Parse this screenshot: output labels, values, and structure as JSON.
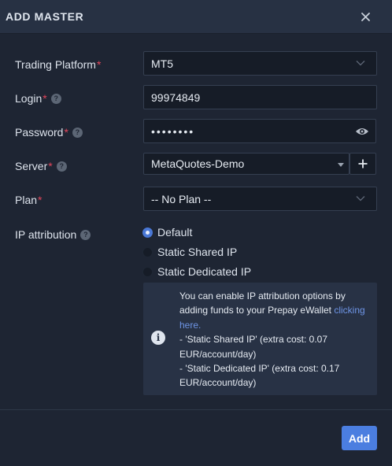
{
  "dialog": {
    "title": "ADD MASTER",
    "close_icon": "close-icon"
  },
  "form": {
    "platform": {
      "label": "Trading Platform",
      "required": "*",
      "value": "MT5"
    },
    "login": {
      "label": "Login",
      "required": "*",
      "help": "?",
      "value": "99974849"
    },
    "password": {
      "label": "Password",
      "required": "*",
      "help": "?",
      "value": "••••••••"
    },
    "server": {
      "label": "Server",
      "required": "*",
      "help": "?",
      "value": "MetaQuotes-Demo"
    },
    "plan": {
      "label": "Plan",
      "required": "*",
      "value": "-- No Plan --"
    },
    "ip": {
      "label": "IP attribution",
      "help": "?",
      "options": [
        "Default",
        "Static Shared IP",
        "Static Dedicated IP"
      ],
      "selected": "Default"
    }
  },
  "info": {
    "text_before_link": "You can enable IP attribution options by adding funds to your Prepay eWallet ",
    "link": "clicking here.",
    "line_shared": "- 'Static Shared IP' (extra cost: 0.07 EUR/account/day)",
    "line_dedicated": "- 'Static Dedicated IP' (extra cost: 0.17 EUR/account/day)",
    "icon": "i"
  },
  "footer": {
    "add_label": "Add"
  },
  "colors": {
    "accent": "#4b7ee0",
    "required": "#e2465b",
    "link": "#6e95e6"
  }
}
